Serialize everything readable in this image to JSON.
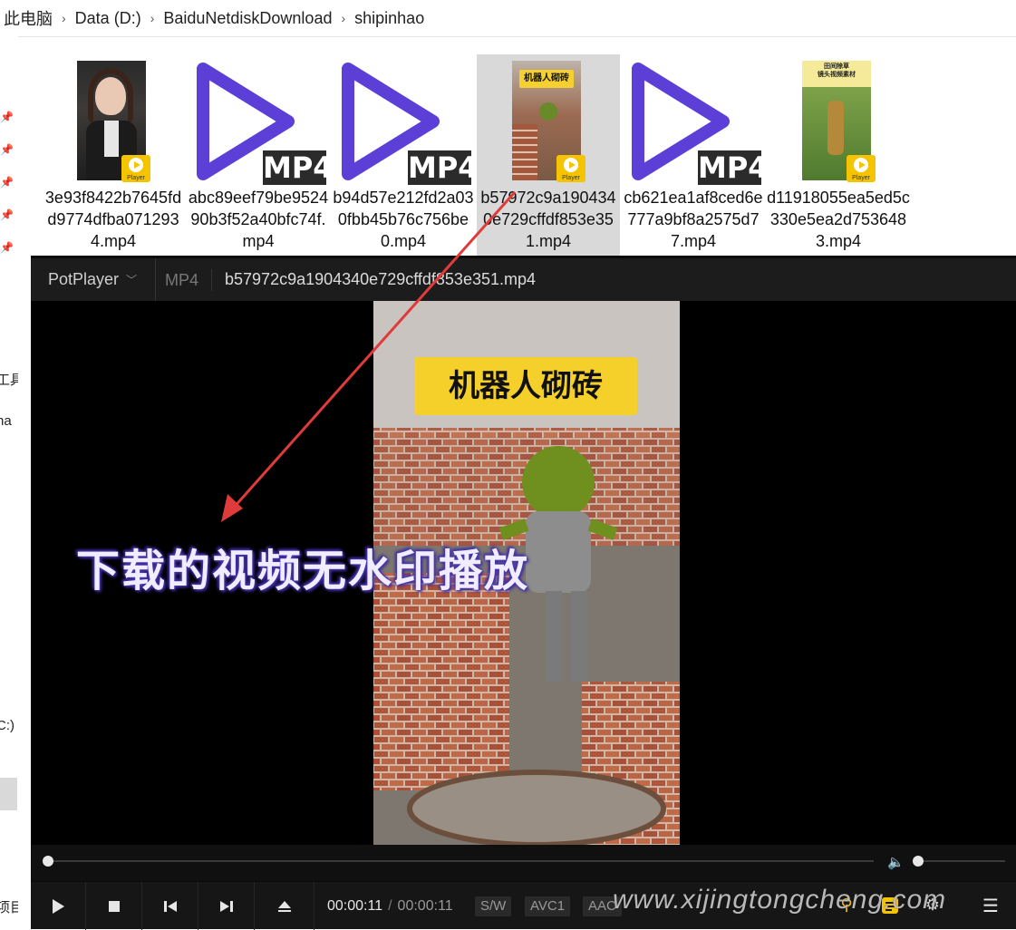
{
  "explorer": {
    "breadcrumb": [
      "此电脑",
      "Data (D:)",
      "BaiduNetdiskDownload",
      "shipinhao"
    ],
    "nav": {
      "tools_label": "工具",
      "na_label": "na",
      "drive_c": "C:)",
      "project_label": "项目"
    },
    "files": [
      {
        "name": "3e93f8422b7645fdd9774dfba0712934.mp4",
        "thumb": "photo",
        "badge": "Player"
      },
      {
        "name": "abc89eef79be952490b3f52a40bfc74f.mp4",
        "thumb": "mp4-icon",
        "tag": "MP4"
      },
      {
        "name": "b94d57e212fd2a030fbb45b76c756be0.mp4",
        "thumb": "mp4-icon",
        "tag": "MP4"
      },
      {
        "name": "b57972c9a1904340e729cffdf853e351.mp4",
        "thumb": "photo",
        "badge": "Player",
        "poster": "机器人砌砖"
      },
      {
        "name": "cb621ea1af8ced6e777a9bf8a2575d77.mp4",
        "thumb": "mp4-icon",
        "tag": "MP4"
      },
      {
        "name": "d11918055ea5ed5c330e5ea2d7536483.mp4",
        "thumb": "photo",
        "badge": "Player",
        "poster_line1": "田间除草",
        "poster_line2": "镜头视频素材"
      }
    ]
  },
  "player": {
    "brand": "PotPlayer",
    "format": "MP4",
    "filename": "b57972c9a1904340e729cffdf853e351.mp4",
    "video_title": "机器人砌砖",
    "overlay_text": "下载的视频无水印播放",
    "time_current": "00:00:11",
    "time_separator": "/",
    "time_total": "00:00:11",
    "tags": [
      "S/W",
      "AVC1",
      "AAC"
    ],
    "progress_fraction": 0.0,
    "volume_fraction": 0.0,
    "watermark": "www.xijingtongcheng.com"
  },
  "colors": {
    "accent_play": "#5b3fd6",
    "badge_yellow": "#f5c400",
    "annotation_red": "#e03b3b"
  }
}
